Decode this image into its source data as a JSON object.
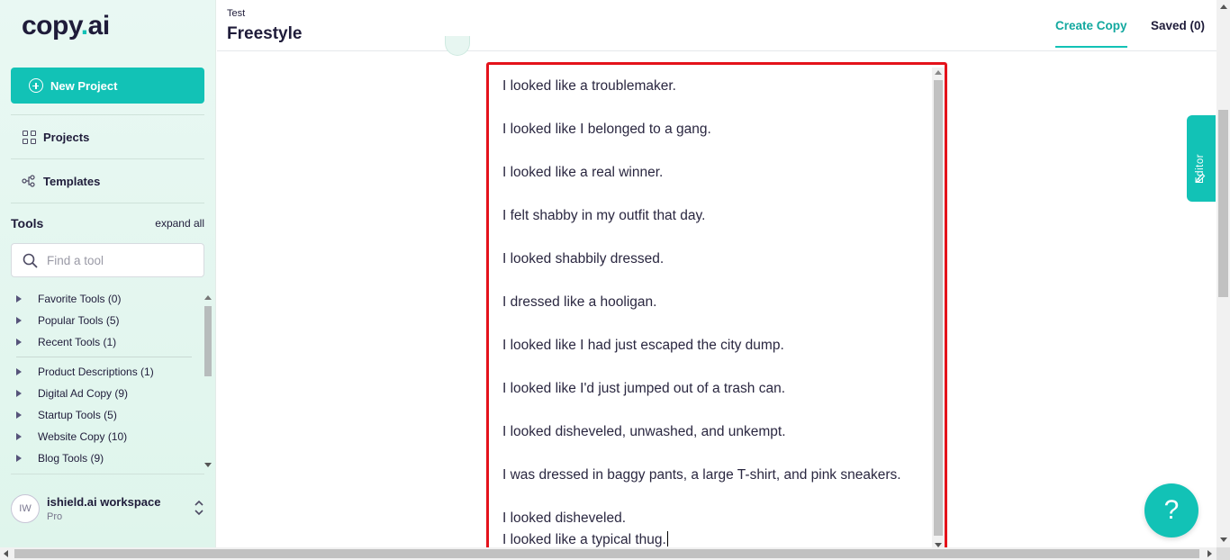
{
  "brand": {
    "logo_pre": "copy",
    "logo_dot": ".",
    "logo_post": "ai"
  },
  "sidebar": {
    "new_project_label": "New Project",
    "nav": [
      {
        "label": "Projects",
        "icon": "grid-icon"
      },
      {
        "label": "Templates",
        "icon": "templates-icon"
      }
    ],
    "tools_title": "Tools",
    "expand_all": "expand all",
    "search_placeholder": "Find a tool",
    "tool_groups_top": [
      "Favorite Tools (0)",
      "Popular Tools (5)",
      "Recent Tools (1)"
    ],
    "tool_groups": [
      "Product Descriptions (1)",
      "Digital Ad Copy (9)",
      "Startup Tools (5)",
      "Website Copy (10)",
      "Blog Tools (9)"
    ],
    "workspace": {
      "initials": "IW",
      "name": "ishield.ai workspace",
      "plan": "Pro"
    }
  },
  "header": {
    "breadcrumb": "Test",
    "title": "Freestyle",
    "tabs": [
      "Create Copy",
      "Saved (0)"
    ],
    "active_tab": "Create Copy"
  },
  "editor": {
    "lines": [
      "I looked like a troublemaker.",
      "I looked like I belonged to a gang.",
      "I looked like a real winner.",
      "I felt shabby in my outfit that day.",
      "I looked shabbily dressed.",
      "I dressed like a hooligan.",
      "I looked like I had just escaped the city dump.",
      "I looked like I'd just jumped out of a trash can.",
      "I looked disheveled, unwashed, and unkempt.",
      "I was dressed in baggy pants, a large T-shirt, and pink sneakers.",
      "I looked disheveled.",
      "I looked like a typical thug."
    ],
    "side_tab_label": "Editor"
  },
  "help_label": "?",
  "colors": {
    "accent": "#12c2b6",
    "highlight_border": "#e4121b",
    "text": "#1f1c3a"
  }
}
